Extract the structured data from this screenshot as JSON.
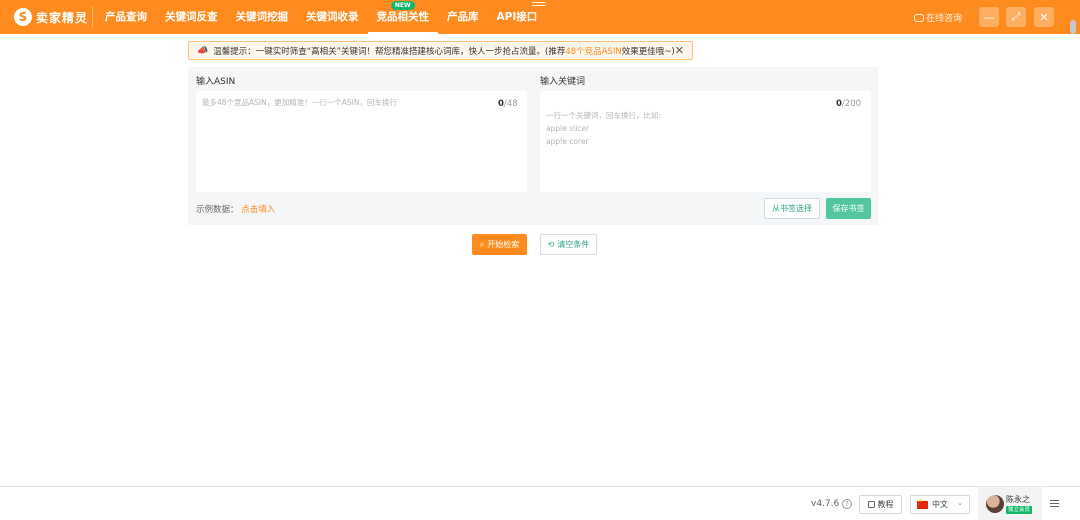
{
  "app": {
    "logo_text": "卖家精灵",
    "logo_mark": "S"
  },
  "nav": {
    "items": [
      {
        "label": "产品查询"
      },
      {
        "label": "关键词反查"
      },
      {
        "label": "关键词挖掘"
      },
      {
        "label": "关键词收录"
      },
      {
        "label": "竞品相关性",
        "badge": "NEW",
        "active": true
      },
      {
        "label": "产品库"
      },
      {
        "label": "API接口"
      }
    ]
  },
  "topbar": {
    "consult_label": "在线咨询",
    "minimize": "—",
    "maximize": "⤢",
    "close": "✕"
  },
  "notice": {
    "prefix": "温馨提示：一键实时筛查“高相关”关键词！帮您精准搭建核心词库，快人一步抢占流量。(推荐",
    "highlight": "48个竞品ASIN",
    "suffix": "效果更佳哦~)",
    "close": "✕"
  },
  "asin": {
    "label": "输入ASIN",
    "placeholder": "最多48个竞品ASIN，更加精准！一行一个ASIN，回车换行",
    "count": "0",
    "max": "/48"
  },
  "keywords": {
    "label": "输入关键词",
    "placeholder": "一行一个关键词，回车换行，比如:\napple slicer\napple corer",
    "count": "0",
    "max": "/200"
  },
  "example": {
    "label": "示例数据：",
    "link": "点击填入"
  },
  "buttons": {
    "from_bookmark": "从书签选择",
    "save_bookmark": "保存书签",
    "search": "开始检索",
    "clear": "清空条件"
  },
  "footer": {
    "version": "v4.7.6",
    "help": "?",
    "tutorial": "教程",
    "language": "中文",
    "username": "陈永之",
    "vip": "独立会员"
  },
  "colors": {
    "brand": "#ff8a1e",
    "green": "#53c6a1",
    "badge_green": "#12b76a"
  }
}
